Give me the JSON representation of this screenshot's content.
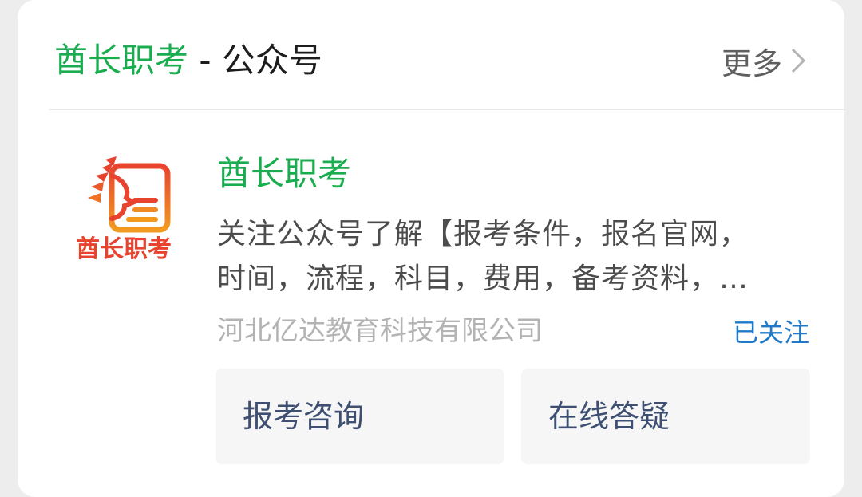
{
  "header": {
    "account_highlight": "酋长职考",
    "separator_text": " - 公众号",
    "more_label": "更多"
  },
  "account": {
    "logo_text": "酋长职考",
    "name": "酋长职考",
    "description_line1": "关注公众号了解【报考条件，报名官网，",
    "description_line2": "时间，流程，科目，费用，备考资料，…",
    "company": "河北亿达教育科技有限公司",
    "follow_status": "已关注"
  },
  "actions": [
    {
      "label": "报考咨询"
    },
    {
      "label": "在线答疑"
    }
  ],
  "colors": {
    "brand_green": "#1aad4f",
    "link_blue": "#1f78c8",
    "logo_red": "#e8432f",
    "logo_orange": "#f39a1e"
  }
}
